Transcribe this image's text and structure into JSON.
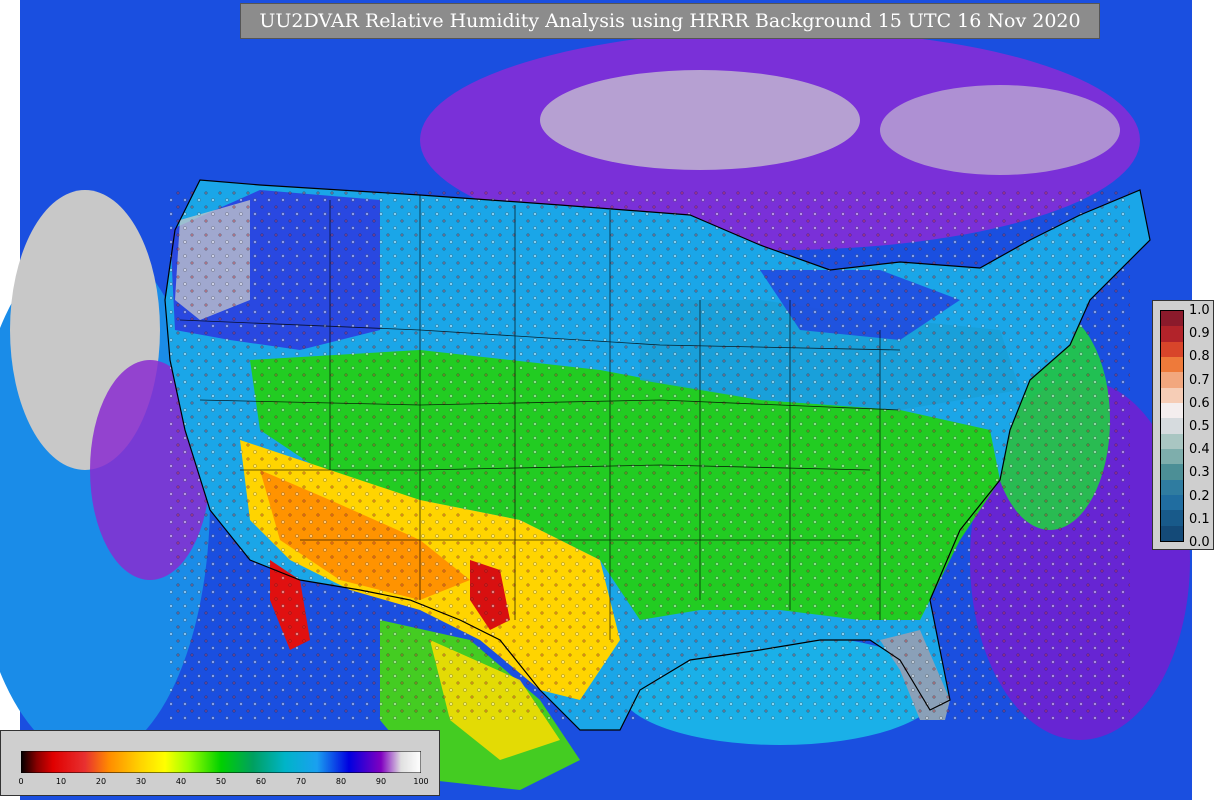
{
  "title": "UU2DVAR Relative Humidity Analysis using HRRR Background 15 UTC 16 Nov 2020",
  "colorbar_right": {
    "ticks": [
      "1.0",
      "0.9",
      "0.8",
      "0.7",
      "0.6",
      "0.5",
      "0.4",
      "0.3",
      "0.2",
      "0.1",
      "0.0"
    ],
    "colors": [
      "#8b1a2b",
      "#b2232a",
      "#d8452a",
      "#ee7a3a",
      "#f2a77e",
      "#f6cdb6",
      "#f4eeee",
      "#d6dbde",
      "#a9c6c2",
      "#7eaeac",
      "#4c8f96",
      "#2f7ca0",
      "#206da0",
      "#185a8a",
      "#144a78"
    ]
  },
  "colorbar_bottom": {
    "ticks": [
      "0",
      "10",
      "20",
      "30",
      "40",
      "50",
      "60",
      "70",
      "80",
      "90",
      "100"
    ]
  },
  "colors": {
    "ocean": "#1a4fe0",
    "land_moist": "#1aa6e8",
    "land_dry": "#ffd400",
    "very_dry": "#e0111b",
    "green_mid": "#22cc22",
    "high_rh": "#7a1ad0",
    "saturated": "#cccccc"
  }
}
